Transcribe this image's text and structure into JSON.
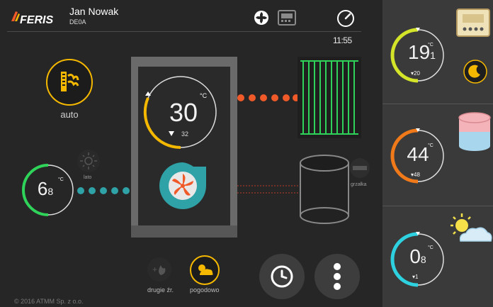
{
  "header": {
    "brand": "FERIS",
    "user_name": "Jan Nowak",
    "user_code": "DE0A",
    "time": "11:55"
  },
  "mode": {
    "label": "auto"
  },
  "boiler": {
    "temp_value": "30",
    "temp_unit": "°C",
    "temp_setpoint": "32"
  },
  "outdoor": {
    "temp_main": "6",
    "temp_decimal": "8",
    "unit": "°C",
    "summer_label": "lato"
  },
  "heater": {
    "label": "grzałka"
  },
  "bottom": {
    "second_source_label": "drugie źr.",
    "weather_label": "pogodowo"
  },
  "right": {
    "room": {
      "value_main": "19",
      "value_decimal": "1",
      "unit": "°C",
      "setpoint": "▾20",
      "accent": "#d4e428"
    },
    "water": {
      "value_main": "44",
      "value_decimal": "",
      "unit": "°C",
      "setpoint": "▾48",
      "accent": "#f07a1a"
    },
    "outside": {
      "value_main": "0",
      "value_decimal": "8",
      "unit": "°C",
      "setpoint": "▾1",
      "accent": "#2ed1e0"
    }
  },
  "footer": {
    "copyright": "© 2016 ATMM Sp. z o.o."
  },
  "colors": {
    "accent_yellow": "#f5b800",
    "accent_orange": "#f05a28",
    "accent_teal": "#2ea2a6",
    "accent_green": "#2fd35a"
  }
}
